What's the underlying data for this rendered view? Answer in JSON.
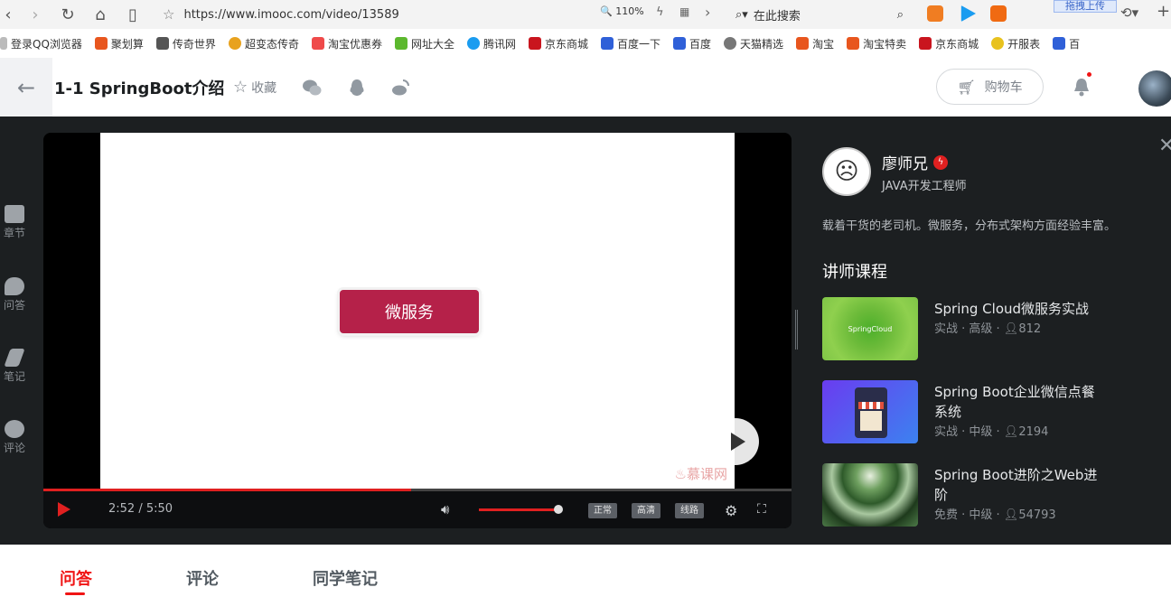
{
  "browser": {
    "url": "https://www.imooc.com/video/13589",
    "zoom": "110%",
    "search_placeholder": "在此搜索",
    "drag_upload": "拖拽上传"
  },
  "bookmarks": [
    "登录QQ浏览器",
    "聚划算",
    "传奇世界",
    "超变态传奇",
    "淘宝优惠券",
    "网址大全",
    "腾讯网",
    "京东商城",
    "百度一下",
    "百度",
    "天猫精选",
    "淘宝",
    "淘宝特卖",
    "京东商城",
    "开服表",
    "百"
  ],
  "header": {
    "lesson_title": "1-1 SpringBoot介绍",
    "collect_label": "收藏",
    "cart_label": "购物车"
  },
  "side_nav": [
    "章节",
    "问答",
    "笔记",
    "评论"
  ],
  "player": {
    "slide_button": "微服务",
    "watermark": "慕课网",
    "current_time": "2:52",
    "duration": "5:50",
    "time_display": "2:52 / 5:50",
    "progress_fraction": 0.491,
    "quality_options": [
      "正常",
      "高清",
      "线路"
    ]
  },
  "teacher": {
    "name": "廖师兄",
    "role": "JAVA开发工程师",
    "description": "载着干货的老司机。微服务，分布式架构方面经验丰富。",
    "courses_title": "讲师课程"
  },
  "courses": [
    {
      "title": "Spring Cloud微服务实战",
      "meta": "实战 · 高级 · ",
      "students": "812",
      "thumb_label": "SpringCloud"
    },
    {
      "title": "Spring Boot企业微信点餐系统",
      "meta": "实战 · 中级 · ",
      "students": "2194",
      "thumb_label": ""
    },
    {
      "title": "Spring Boot进阶之Web进阶",
      "meta": "免费 · 中级 · ",
      "students": "54793",
      "thumb_label": ""
    }
  ],
  "tabs": [
    "问答",
    "评论",
    "同学笔记"
  ],
  "colors": {
    "accent": "#f01414",
    "dark_bg": "#1c1f21",
    "slide_button": "#b52149"
  }
}
